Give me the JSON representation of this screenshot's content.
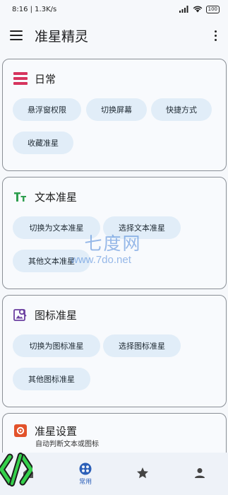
{
  "status_bar": {
    "time_speed": "8:16 | 1.3K/s",
    "battery": "100"
  },
  "app_bar": {
    "title": "准星精灵"
  },
  "cards": {
    "daily": {
      "title": "日常",
      "chips": [
        "悬浮窗权限",
        "切换屏幕",
        "快捷方式",
        "收藏准星"
      ]
    },
    "text": {
      "title": "文本准星",
      "chips": [
        "切换为文本准星",
        "选择文本准星",
        "其他文本准星"
      ]
    },
    "icon": {
      "title": "图标准星",
      "chips": [
        "切换为图标准星",
        "选择图标准星",
        "其他图标准星"
      ]
    },
    "settings": {
      "title": "准星设置",
      "subtitle": "自动判断文本或图标"
    }
  },
  "bottom_nav": {
    "items": [
      {
        "label": ""
      },
      {
        "label": "常用"
      },
      {
        "label": ""
      },
      {
        "label": ""
      }
    ]
  },
  "watermark": {
    "cn": "七度网",
    "url": "www.7do.net"
  },
  "colors": {
    "accent": "#2b5fb8",
    "chip_bg": "#e1edf8",
    "daily_icon": "#d6345e",
    "text_icon": "#2e9e4f",
    "icon_icon": "#6b3fa0",
    "settings_icon": "#e2522b"
  }
}
